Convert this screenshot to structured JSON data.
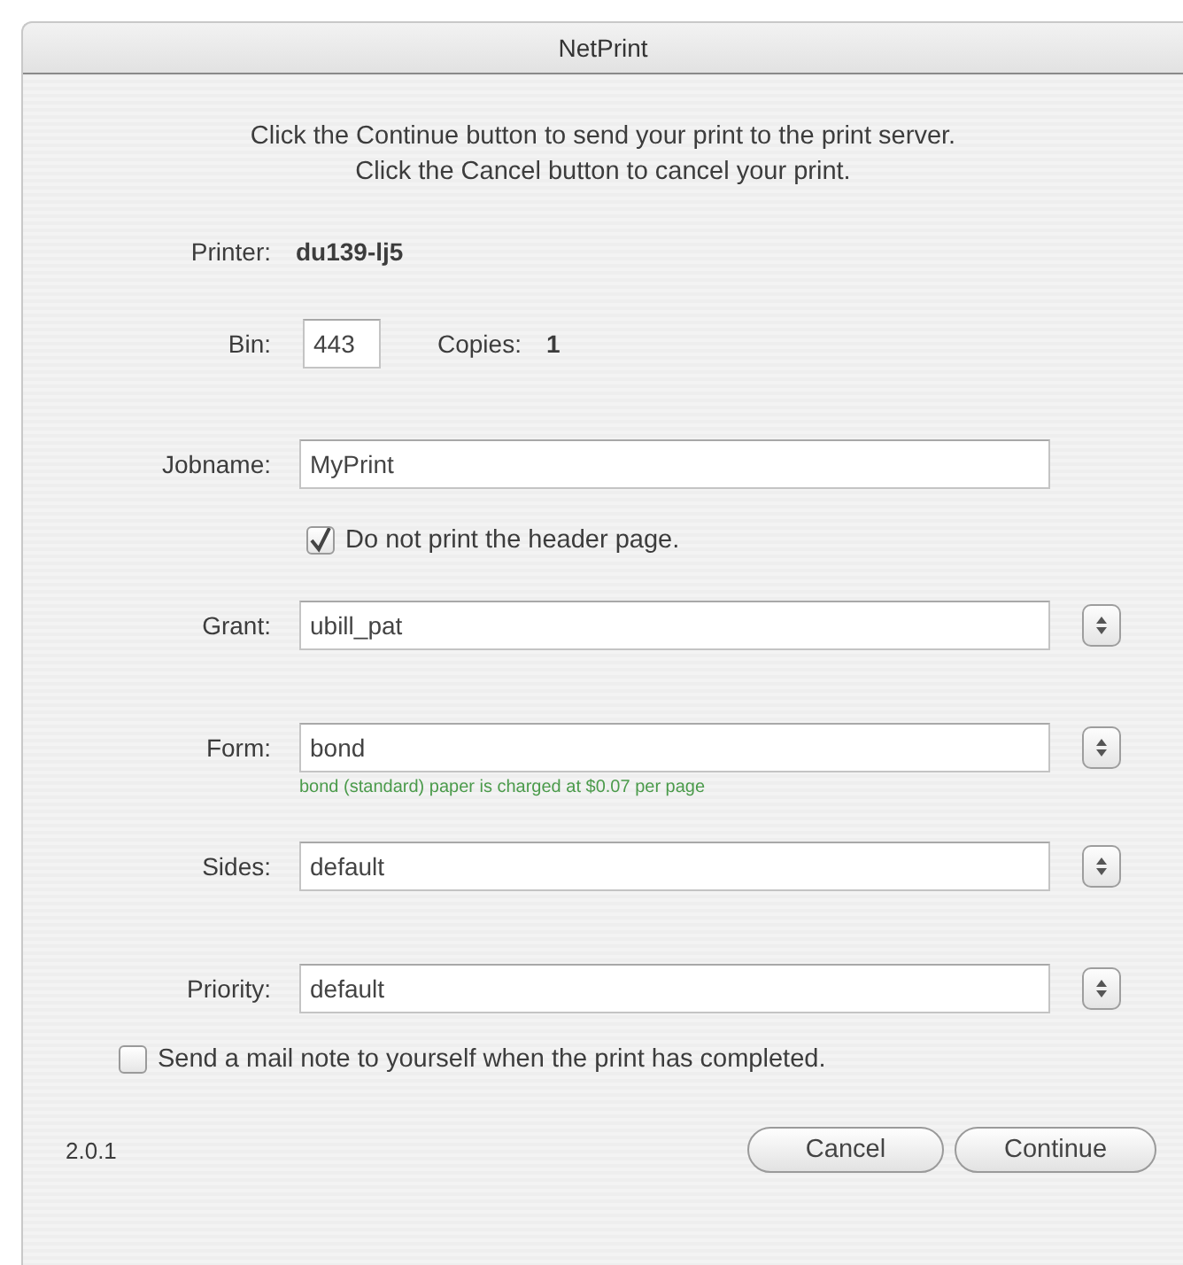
{
  "window": {
    "title": "NetPrint"
  },
  "instructions": [
    "Click the Continue button to send your print to the print server.",
    "Click the Cancel button to cancel your print."
  ],
  "printer": {
    "label": "Printer:",
    "value": "du139-lj5"
  },
  "bin": {
    "label": "Bin:",
    "value": "443"
  },
  "copies": {
    "label": "Copies:",
    "value": "1"
  },
  "jobname": {
    "label": "Jobname:",
    "value": "MyPrint"
  },
  "header_option": {
    "label": "Do not print the header page.",
    "checked": true
  },
  "fields": [
    {
      "label": "Grant:",
      "value": "ubill_pat"
    },
    {
      "label": "Form:",
      "value": "bond",
      "note": "bond (standard) paper is charged at $0.07 per page"
    },
    {
      "label": "Sides:",
      "value": "default"
    },
    {
      "label": "Priority:",
      "value": "default"
    }
  ],
  "mail_option": {
    "label": "Send a mail note to yourself when the print has completed.",
    "checked": false
  },
  "version": "2.0.1",
  "buttons": [
    "Cancel",
    "Continue"
  ]
}
